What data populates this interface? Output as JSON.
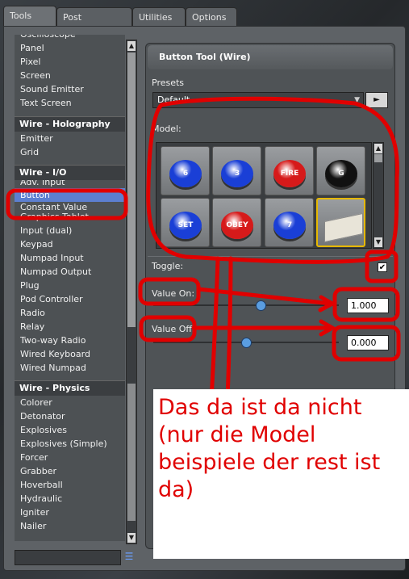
{
  "tabs": [
    "Tools",
    "Post Processing",
    "Utilities",
    "Options"
  ],
  "tool_list": {
    "top_items": [
      "Oscilloscope",
      "Panel",
      "Pixel",
      "Screen",
      "Sound Emitter",
      "Text Screen"
    ],
    "categories": [
      {
        "title": "Wire - Holography",
        "items": [
          "Emitter",
          "Grid"
        ]
      },
      {
        "title": "Wire - I/O",
        "items": [
          "Adv. Input",
          "Button",
          "Constant Value",
          "Graphics Tablet",
          "Input (dual)",
          "Keypad",
          "Numpad Input",
          "Numpad Output",
          "Plug",
          "Pod Controller",
          "Radio",
          "Relay",
          "Two-way Radio",
          "Wired Keyboard",
          "Wired Numpad"
        ]
      },
      {
        "title": "Wire - Physics",
        "items": [
          "Colorer",
          "Detonator",
          "Explosives",
          "Explosives (Simple)",
          "Forcer",
          "Grabber",
          "Hoverball",
          "Hydraulic",
          "Igniter",
          "Nailer"
        ]
      }
    ],
    "selected": "Button"
  },
  "panel": {
    "title": "Button Tool (Wire)",
    "presets_label": "Presets",
    "preset_value": "Default",
    "model_label": "Model:",
    "toggle_label": "Toggle:",
    "toggle_checked": true,
    "value_on_label": "Value On:",
    "value_on": "1.000",
    "value_off_label": "Value Off:",
    "value_off": "0.000",
    "value_on_fraction": 0.58,
    "value_off_fraction": 0.5
  },
  "models": [
    {
      "color": "#1a3fd6",
      "label": "6"
    },
    {
      "color": "#1a3fd6",
      "label": "3"
    },
    {
      "color": "#d61a1a",
      "label": "FIRE"
    },
    {
      "color": "#111111",
      "label": "G"
    },
    {
      "color": "#1a3fd6",
      "label": "SET"
    },
    {
      "color": "#d61a1a",
      "label": "OBEY"
    },
    {
      "color": "#1a3fd6",
      "label": "7"
    },
    {
      "color": "#e8e4d8",
      "label": ""
    }
  ],
  "annotation": {
    "text": "Das da ist da nicht\n(nur die Model\nbeispiele der rest ist\nda)",
    "color": "#e00000"
  }
}
